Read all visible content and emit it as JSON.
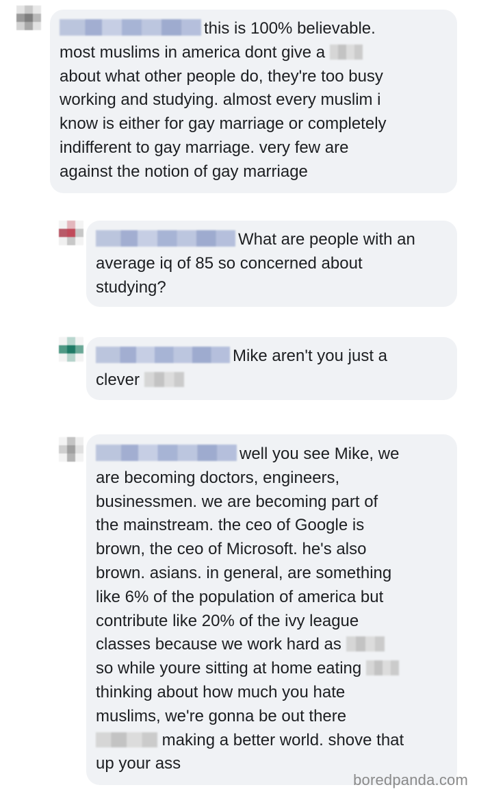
{
  "comments": [
    {
      "avatar_colors": [
        "#e4e4e4",
        "#c9c9c9",
        "#e8e8e8",
        "#9a9a9a",
        "#7f7f7f",
        "#b8b8b8",
        "#d2d2d2",
        "#a8a8a8",
        "#e2e2e2"
      ],
      "lines": [
        "this is 100% believable.",
        "most muslims in america dont give a",
        "about what other people do, they're too busy",
        "working and studying. almost every muslim i",
        "know is either for gay marriage or completely",
        "indifferent to gay marriage. very few are",
        "against the notion of gay marriage"
      ]
    },
    {
      "avatar_colors": [
        "#f3f3f3",
        "#e3b7bd",
        "#f3f3f3",
        "#b85a68",
        "#c04a5a",
        "#c7c7c7",
        "#f0f0f0",
        "#c8c8c8",
        "#f3f3f3"
      ],
      "lines": [
        "What are people with an",
        "average iq of 85 so concerned about",
        "studying?"
      ]
    },
    {
      "avatar_colors": [
        "#f3f3f3",
        "#b9d7cf",
        "#f3f3f3",
        "#4f9985",
        "#1f7a66",
        "#6aa897",
        "#f3f3f3",
        "#b5d3cb",
        "#f3f3f3"
      ],
      "lines": [
        "Mike aren't you just a",
        "clever"
      ]
    },
    {
      "avatar_colors": [
        "#f3f3f3",
        "#c4c4c4",
        "#eeeeee",
        "#cfcfcf",
        "#a0a0a0",
        "#e0e0e0",
        "#f3f3f3",
        "#b4b4b4",
        "#f3f3f3"
      ],
      "lines": [
        "well you see Mike, we",
        "are becoming doctors, engineers,",
        "businessmen. we are becoming part of",
        "the mainstream. the ceo of Google is",
        "brown, the ceo of Microsoft. he's also",
        "brown. asians. in general, are something",
        "like 6% of the population of america but",
        "contribute like 20% of the ivy league",
        "classes because we work hard as",
        "so while youre sitting at home eating",
        "thinking about how much you hate",
        "muslims, we're gonna be out there",
        "making a better world. shove that",
        "up your ass"
      ]
    }
  ],
  "watermark": "boredpanda.com"
}
